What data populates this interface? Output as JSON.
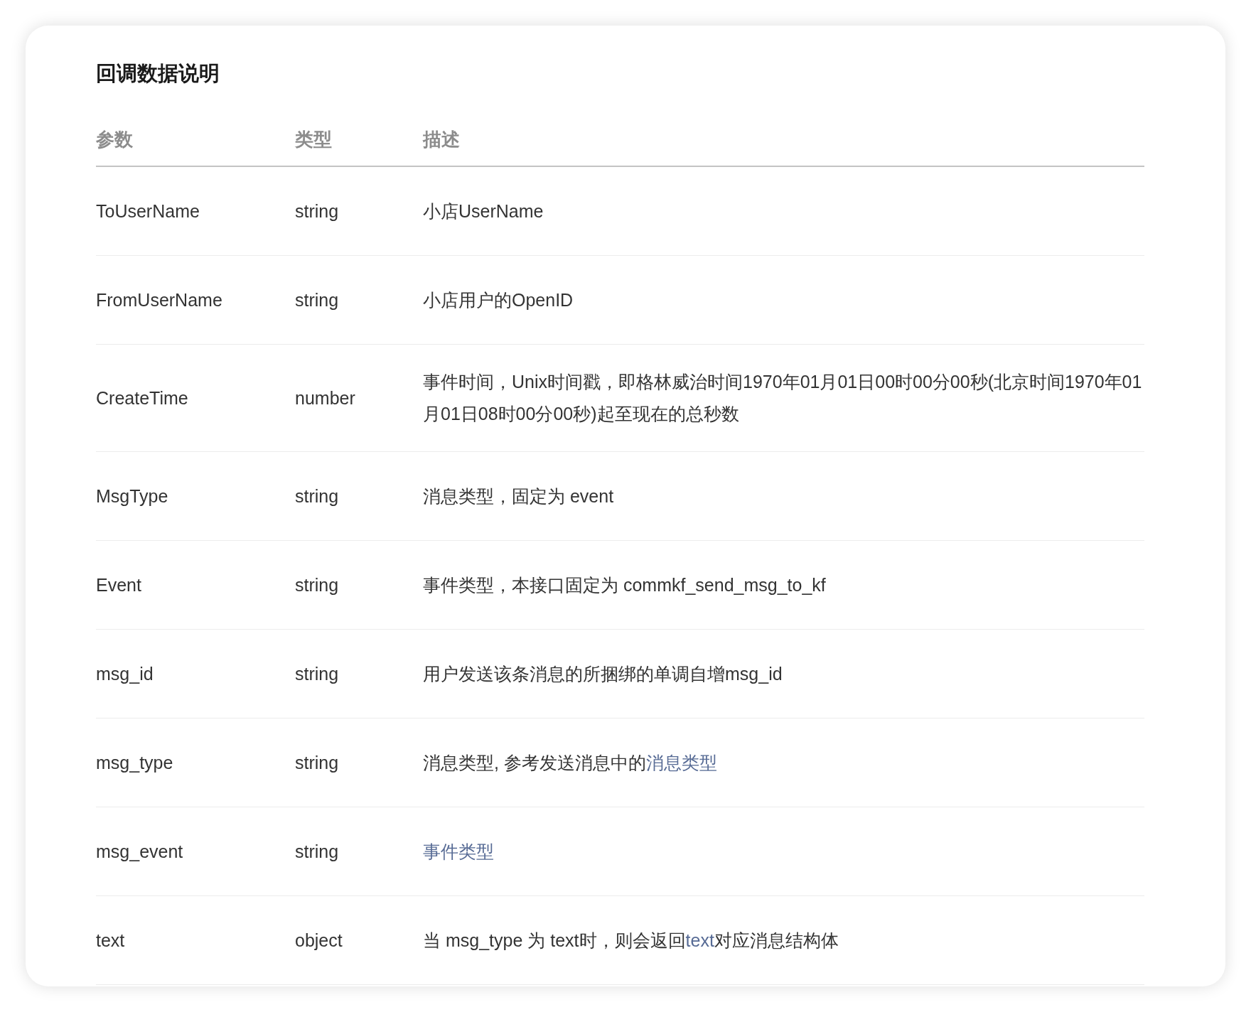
{
  "title": "回调数据说明",
  "table": {
    "columns": [
      "参数",
      "类型",
      "描述"
    ],
    "rows": [
      {
        "param": "ToUserName",
        "type": "string",
        "description": [
          {
            "kind": "text",
            "text": "小店UserName"
          }
        ]
      },
      {
        "param": "FromUserName",
        "type": "string",
        "description": [
          {
            "kind": "text",
            "text": "小店用户的OpenID"
          }
        ]
      },
      {
        "param": "CreateTime",
        "type": "number",
        "description": [
          {
            "kind": "text",
            "text": "事件时间，Unix时间戳，即格林威治时间1970年01月01日00时00分00秒(北京时间1970年01月01日08时00分00秒)起至现在的总秒数"
          }
        ]
      },
      {
        "param": "MsgType",
        "type": "string",
        "description": [
          {
            "kind": "text",
            "text": "消息类型，固定为 event"
          }
        ]
      },
      {
        "param": "Event",
        "type": "string",
        "description": [
          {
            "kind": "text",
            "text": "事件类型，本接口固定为 commkf_send_msg_to_kf"
          }
        ]
      },
      {
        "param": "msg_id",
        "type": "string",
        "description": [
          {
            "kind": "text",
            "text": "用户发送该条消息的所捆绑的单调自增msg_id"
          }
        ]
      },
      {
        "param": "msg_type",
        "type": "string",
        "description": [
          {
            "kind": "text",
            "text": "消息类型, 参考发送消息中的"
          },
          {
            "kind": "link",
            "text": "消息类型"
          }
        ]
      },
      {
        "param": "msg_event",
        "type": "string",
        "description": [
          {
            "kind": "link",
            "text": "事件类型"
          }
        ]
      },
      {
        "param": "text",
        "type": "object",
        "description": [
          {
            "kind": "text",
            "text": "当 msg_type 为 text时，则会返回"
          },
          {
            "kind": "link",
            "text": "text"
          },
          {
            "kind": "text",
            "text": "对应消息结构体"
          }
        ]
      }
    ]
  }
}
